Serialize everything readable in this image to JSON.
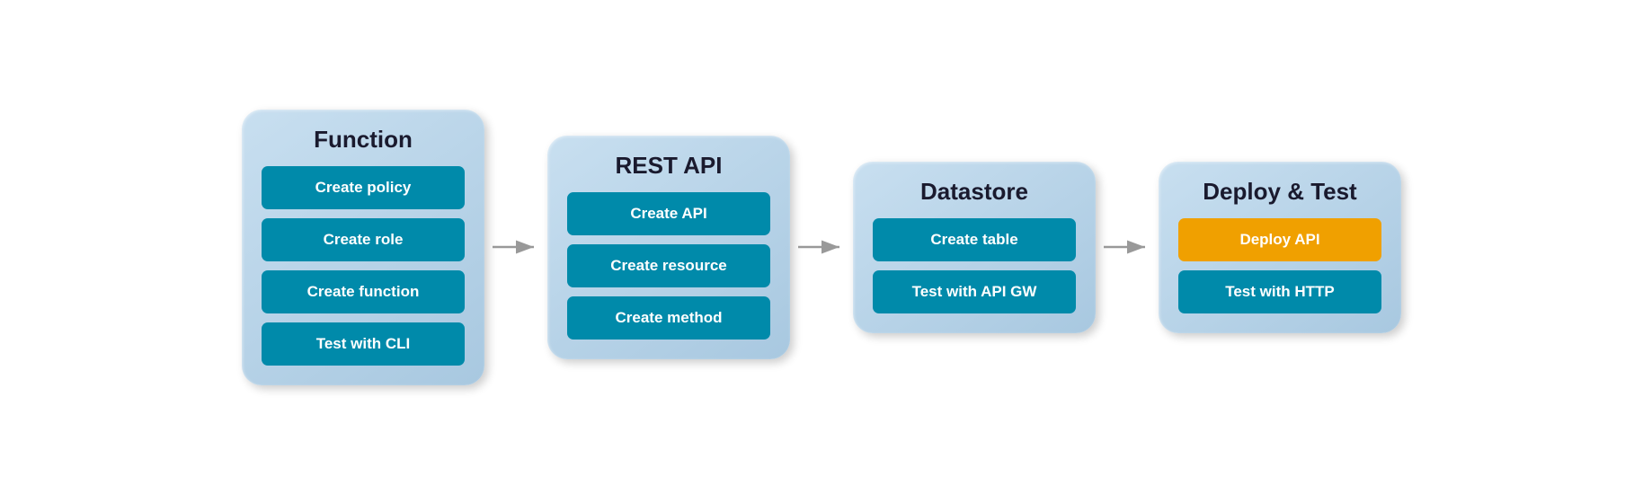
{
  "panels": [
    {
      "id": "function",
      "title": "Function",
      "buttons": [
        {
          "id": "create-policy",
          "label": "Create policy",
          "style": "teal"
        },
        {
          "id": "create-role",
          "label": "Create role",
          "style": "teal"
        },
        {
          "id": "create-function",
          "label": "Create function",
          "style": "teal"
        },
        {
          "id": "test-cli",
          "label": "Test with CLI",
          "style": "teal"
        }
      ]
    },
    {
      "id": "restapi",
      "title": "REST API",
      "buttons": [
        {
          "id": "create-api",
          "label": "Create API",
          "style": "teal"
        },
        {
          "id": "create-resource",
          "label": "Create resource",
          "style": "teal"
        },
        {
          "id": "create-method",
          "label": "Create method",
          "style": "teal"
        }
      ]
    },
    {
      "id": "datastore",
      "title": "Datastore",
      "buttons": [
        {
          "id": "create-table",
          "label": "Create table",
          "style": "teal"
        },
        {
          "id": "test-api-gw",
          "label": "Test with API GW",
          "style": "teal"
        }
      ]
    },
    {
      "id": "deploy",
      "title": "Deploy & Test",
      "buttons": [
        {
          "id": "deploy-api",
          "label": "Deploy API",
          "style": "orange"
        },
        {
          "id": "test-http",
          "label": "Test with HTTP",
          "style": "teal"
        }
      ]
    }
  ],
  "arrows": [
    {
      "id": "arrow-1"
    },
    {
      "id": "arrow-2"
    },
    {
      "id": "arrow-3"
    }
  ]
}
